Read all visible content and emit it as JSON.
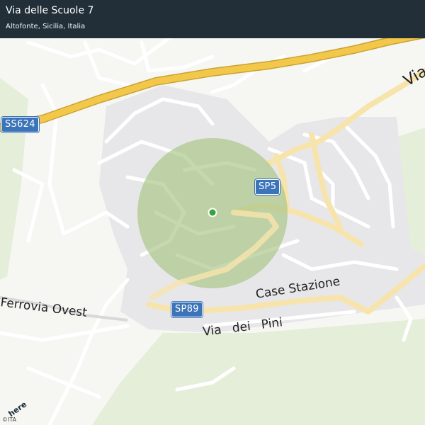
{
  "header": {
    "title": "Via delle Scuole 7",
    "subtitle": "Altofonte, Sicilia, Italia"
  },
  "road_shields": [
    {
      "label": "SS624"
    },
    {
      "label": "SP5"
    },
    {
      "label": "SP89"
    }
  ],
  "street_labels": {
    "ferrovia_ovest": "Ferrovia Ovest",
    "case_stazione": "Case Stazione",
    "via_dei_pini": "Via dei Pini",
    "via_top_right": "Via"
  },
  "branding": {
    "logo_text": "here",
    "copyright": "©ITA"
  },
  "colors": {
    "header_bg": "#222e38",
    "highway": "#f3c84a",
    "secondary_road": "#f7e4ad",
    "minor_road": "#ffffff",
    "urban_area": "#e7e7e9",
    "vegetation": "#e5eed9",
    "accuracy_circle": "#a6c382",
    "location_dot": "#3aa23a",
    "shield_bg": "#3c74b9"
  },
  "location_marker": {
    "accuracy_indicator": true
  }
}
